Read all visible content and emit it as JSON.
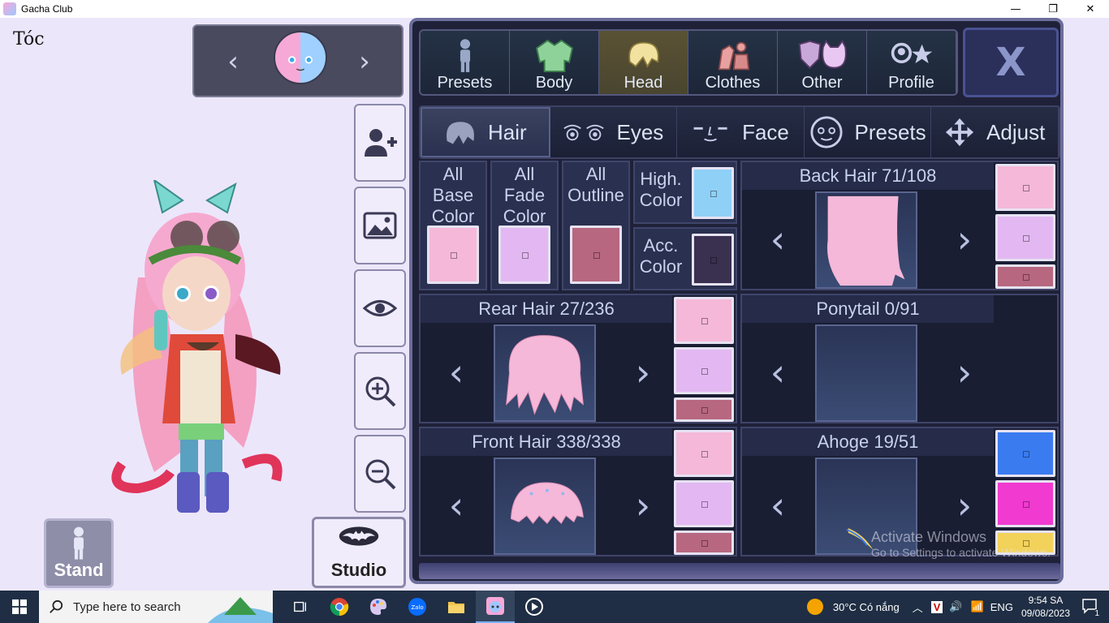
{
  "window": {
    "title": "Gacha Club",
    "minimize": "—",
    "restore": "❐",
    "close": "✕"
  },
  "page_title": "Tóc",
  "preset_nav": {
    "prev": "‹",
    "next": "›"
  },
  "buttons": {
    "stand": "Stand",
    "studio": "Studio",
    "close": "X"
  },
  "category_tabs": [
    {
      "label": "Presets",
      "icon": "person-icon",
      "active": false
    },
    {
      "label": "Body",
      "icon": "jacket-icon",
      "active": false
    },
    {
      "label": "Head",
      "icon": "hair-icon",
      "active": true
    },
    {
      "label": "Clothes",
      "icon": "clothes-icon",
      "active": false
    },
    {
      "label": "Other",
      "icon": "shield-cat-icon",
      "active": false
    },
    {
      "label": "Profile",
      "icon": "profile-star-icon",
      "active": false
    }
  ],
  "sub_tabs": [
    {
      "label": "Hair",
      "icon": "hair-icon",
      "active": true
    },
    {
      "label": "Eyes",
      "icon": "eyes-icon",
      "active": false
    },
    {
      "label": "Face",
      "icon": "face-icon",
      "active": false
    },
    {
      "label": "Presets",
      "icon": "face-circle-icon",
      "active": false
    },
    {
      "label": "Adjust",
      "icon": "move-icon",
      "active": false
    }
  ],
  "color_controls": {
    "base_line1": "All Base",
    "base_line2": "Color",
    "fade_line1": "All Fade",
    "fade_line2": "Color",
    "outline_line1": "All",
    "outline_line2": "Outline",
    "high_line1": "High.",
    "high_line2": "Color",
    "acc_line1": "Acc.",
    "acc_line2": "Color"
  },
  "parts": {
    "back_hair": "Back Hair 71/108",
    "rear_hair": "Rear Hair 27/236",
    "ponytail": "Ponytail 0/91",
    "front_hair": "Front Hair 338/338",
    "ahoge": "Ahoge 19/51"
  },
  "colors": {
    "pink": "#f5b8d8",
    "lilac": "#e3b8f2",
    "mauve": "#b76780",
    "sky": "#8fd0f7",
    "dark": "#3a3050",
    "blue": "#3a7bf0",
    "magenta": "#f03ad0",
    "yellow": "#f2d25a"
  },
  "watermark": {
    "line1": "Activate Windows",
    "line2": "Go to Settings to activate Windows."
  },
  "taskbar": {
    "search_placeholder": "Type here to search",
    "weather": "30°C  Có nắng",
    "lang": "ENG",
    "time": "9:54 SA",
    "date": "09/08/2023",
    "notifications": "1"
  }
}
